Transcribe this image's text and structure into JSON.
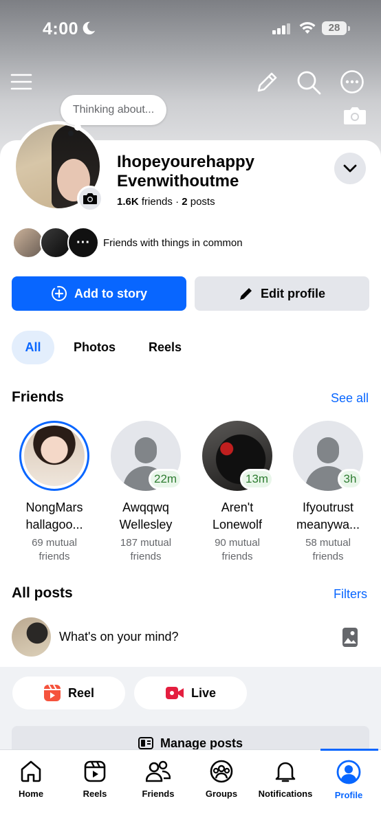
{
  "status_bar": {
    "time": "4:00",
    "battery": "28"
  },
  "profile": {
    "note_placeholder": "Thinking about...",
    "name_line1": "Ihopeyourehappy",
    "name_line2": "Evenwithoutme",
    "friends_count": "1.6K",
    "friends_label": "friends",
    "separator": "·",
    "posts_count": "2",
    "posts_label": "posts",
    "common_friends_text": "Friends with things in common",
    "more_glyph": "···"
  },
  "actions": {
    "add_story": "Add to story",
    "edit_profile": "Edit profile"
  },
  "tabs": [
    {
      "label": "All",
      "active": true
    },
    {
      "label": "Photos",
      "active": false
    },
    {
      "label": "Reels",
      "active": false
    }
  ],
  "friends": {
    "title": "Friends",
    "see_all": "See all",
    "items": [
      {
        "name1": "NongMars",
        "name2": "hallagoo...",
        "mutual1": "69 mutual",
        "mutual2": "friends",
        "badge": ""
      },
      {
        "name1": "Awqqwq",
        "name2": "Wellesley",
        "mutual1": "187 mutual",
        "mutual2": "friends",
        "badge": "22m"
      },
      {
        "name1": "Aren't",
        "name2": "Lonewolf",
        "mutual1": "90 mutual",
        "mutual2": "friends",
        "badge": "13m"
      },
      {
        "name1": "Ifyoutrust",
        "name2": "meanywa...",
        "mutual1": "58 mutual",
        "mutual2": "friends",
        "badge": "3h"
      }
    ]
  },
  "posts": {
    "title": "All posts",
    "filters": "Filters",
    "composer_placeholder": "What's on your mind?",
    "reel": "Reel",
    "live": "Live",
    "manage": "Manage posts"
  },
  "nav": [
    {
      "label": "Home",
      "icon": "home-icon"
    },
    {
      "label": "Reels",
      "icon": "reels-icon"
    },
    {
      "label": "Friends",
      "icon": "friends-icon"
    },
    {
      "label": "Groups",
      "icon": "groups-icon"
    },
    {
      "label": "Notifications",
      "icon": "bell-icon"
    },
    {
      "label": "Profile",
      "icon": "profile-icon",
      "active": true
    }
  ],
  "colors": {
    "accent": "#0866ff",
    "badge_text": "#2f7d32",
    "badge_bg": "#e9f6ea",
    "live_red": "#e41e3f"
  }
}
